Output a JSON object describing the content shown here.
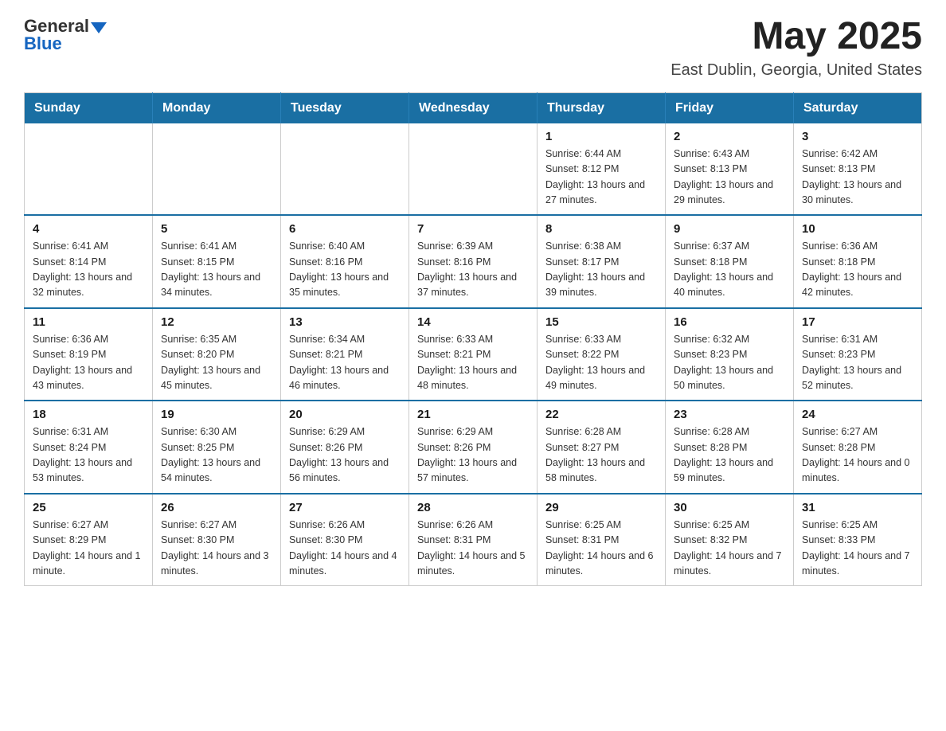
{
  "header": {
    "logo": {
      "text_general": "General",
      "text_blue": "Blue",
      "aria_label": "GeneralBlue Logo"
    },
    "title": "May 2025",
    "subtitle": "East Dublin, Georgia, United States"
  },
  "calendar": {
    "days_of_week": [
      "Sunday",
      "Monday",
      "Tuesday",
      "Wednesday",
      "Thursday",
      "Friday",
      "Saturday"
    ],
    "weeks": [
      {
        "days": [
          {
            "number": "",
            "info": ""
          },
          {
            "number": "",
            "info": ""
          },
          {
            "number": "",
            "info": ""
          },
          {
            "number": "",
            "info": ""
          },
          {
            "number": "1",
            "info": "Sunrise: 6:44 AM\nSunset: 8:12 PM\nDaylight: 13 hours and 27 minutes."
          },
          {
            "number": "2",
            "info": "Sunrise: 6:43 AM\nSunset: 8:13 PM\nDaylight: 13 hours and 29 minutes."
          },
          {
            "number": "3",
            "info": "Sunrise: 6:42 AM\nSunset: 8:13 PM\nDaylight: 13 hours and 30 minutes."
          }
        ]
      },
      {
        "days": [
          {
            "number": "4",
            "info": "Sunrise: 6:41 AM\nSunset: 8:14 PM\nDaylight: 13 hours and 32 minutes."
          },
          {
            "number": "5",
            "info": "Sunrise: 6:41 AM\nSunset: 8:15 PM\nDaylight: 13 hours and 34 minutes."
          },
          {
            "number": "6",
            "info": "Sunrise: 6:40 AM\nSunset: 8:16 PM\nDaylight: 13 hours and 35 minutes."
          },
          {
            "number": "7",
            "info": "Sunrise: 6:39 AM\nSunset: 8:16 PM\nDaylight: 13 hours and 37 minutes."
          },
          {
            "number": "8",
            "info": "Sunrise: 6:38 AM\nSunset: 8:17 PM\nDaylight: 13 hours and 39 minutes."
          },
          {
            "number": "9",
            "info": "Sunrise: 6:37 AM\nSunset: 8:18 PM\nDaylight: 13 hours and 40 minutes."
          },
          {
            "number": "10",
            "info": "Sunrise: 6:36 AM\nSunset: 8:18 PM\nDaylight: 13 hours and 42 minutes."
          }
        ]
      },
      {
        "days": [
          {
            "number": "11",
            "info": "Sunrise: 6:36 AM\nSunset: 8:19 PM\nDaylight: 13 hours and 43 minutes."
          },
          {
            "number": "12",
            "info": "Sunrise: 6:35 AM\nSunset: 8:20 PM\nDaylight: 13 hours and 45 minutes."
          },
          {
            "number": "13",
            "info": "Sunrise: 6:34 AM\nSunset: 8:21 PM\nDaylight: 13 hours and 46 minutes."
          },
          {
            "number": "14",
            "info": "Sunrise: 6:33 AM\nSunset: 8:21 PM\nDaylight: 13 hours and 48 minutes."
          },
          {
            "number": "15",
            "info": "Sunrise: 6:33 AM\nSunset: 8:22 PM\nDaylight: 13 hours and 49 minutes."
          },
          {
            "number": "16",
            "info": "Sunrise: 6:32 AM\nSunset: 8:23 PM\nDaylight: 13 hours and 50 minutes."
          },
          {
            "number": "17",
            "info": "Sunrise: 6:31 AM\nSunset: 8:23 PM\nDaylight: 13 hours and 52 minutes."
          }
        ]
      },
      {
        "days": [
          {
            "number": "18",
            "info": "Sunrise: 6:31 AM\nSunset: 8:24 PM\nDaylight: 13 hours and 53 minutes."
          },
          {
            "number": "19",
            "info": "Sunrise: 6:30 AM\nSunset: 8:25 PM\nDaylight: 13 hours and 54 minutes."
          },
          {
            "number": "20",
            "info": "Sunrise: 6:29 AM\nSunset: 8:26 PM\nDaylight: 13 hours and 56 minutes."
          },
          {
            "number": "21",
            "info": "Sunrise: 6:29 AM\nSunset: 8:26 PM\nDaylight: 13 hours and 57 minutes."
          },
          {
            "number": "22",
            "info": "Sunrise: 6:28 AM\nSunset: 8:27 PM\nDaylight: 13 hours and 58 minutes."
          },
          {
            "number": "23",
            "info": "Sunrise: 6:28 AM\nSunset: 8:28 PM\nDaylight: 13 hours and 59 minutes."
          },
          {
            "number": "24",
            "info": "Sunrise: 6:27 AM\nSunset: 8:28 PM\nDaylight: 14 hours and 0 minutes."
          }
        ]
      },
      {
        "days": [
          {
            "number": "25",
            "info": "Sunrise: 6:27 AM\nSunset: 8:29 PM\nDaylight: 14 hours and 1 minute."
          },
          {
            "number": "26",
            "info": "Sunrise: 6:27 AM\nSunset: 8:30 PM\nDaylight: 14 hours and 3 minutes."
          },
          {
            "number": "27",
            "info": "Sunrise: 6:26 AM\nSunset: 8:30 PM\nDaylight: 14 hours and 4 minutes."
          },
          {
            "number": "28",
            "info": "Sunrise: 6:26 AM\nSunset: 8:31 PM\nDaylight: 14 hours and 5 minutes."
          },
          {
            "number": "29",
            "info": "Sunrise: 6:25 AM\nSunset: 8:31 PM\nDaylight: 14 hours and 6 minutes."
          },
          {
            "number": "30",
            "info": "Sunrise: 6:25 AM\nSunset: 8:32 PM\nDaylight: 14 hours and 7 minutes."
          },
          {
            "number": "31",
            "info": "Sunrise: 6:25 AM\nSunset: 8:33 PM\nDaylight: 14 hours and 7 minutes."
          }
        ]
      }
    ]
  }
}
